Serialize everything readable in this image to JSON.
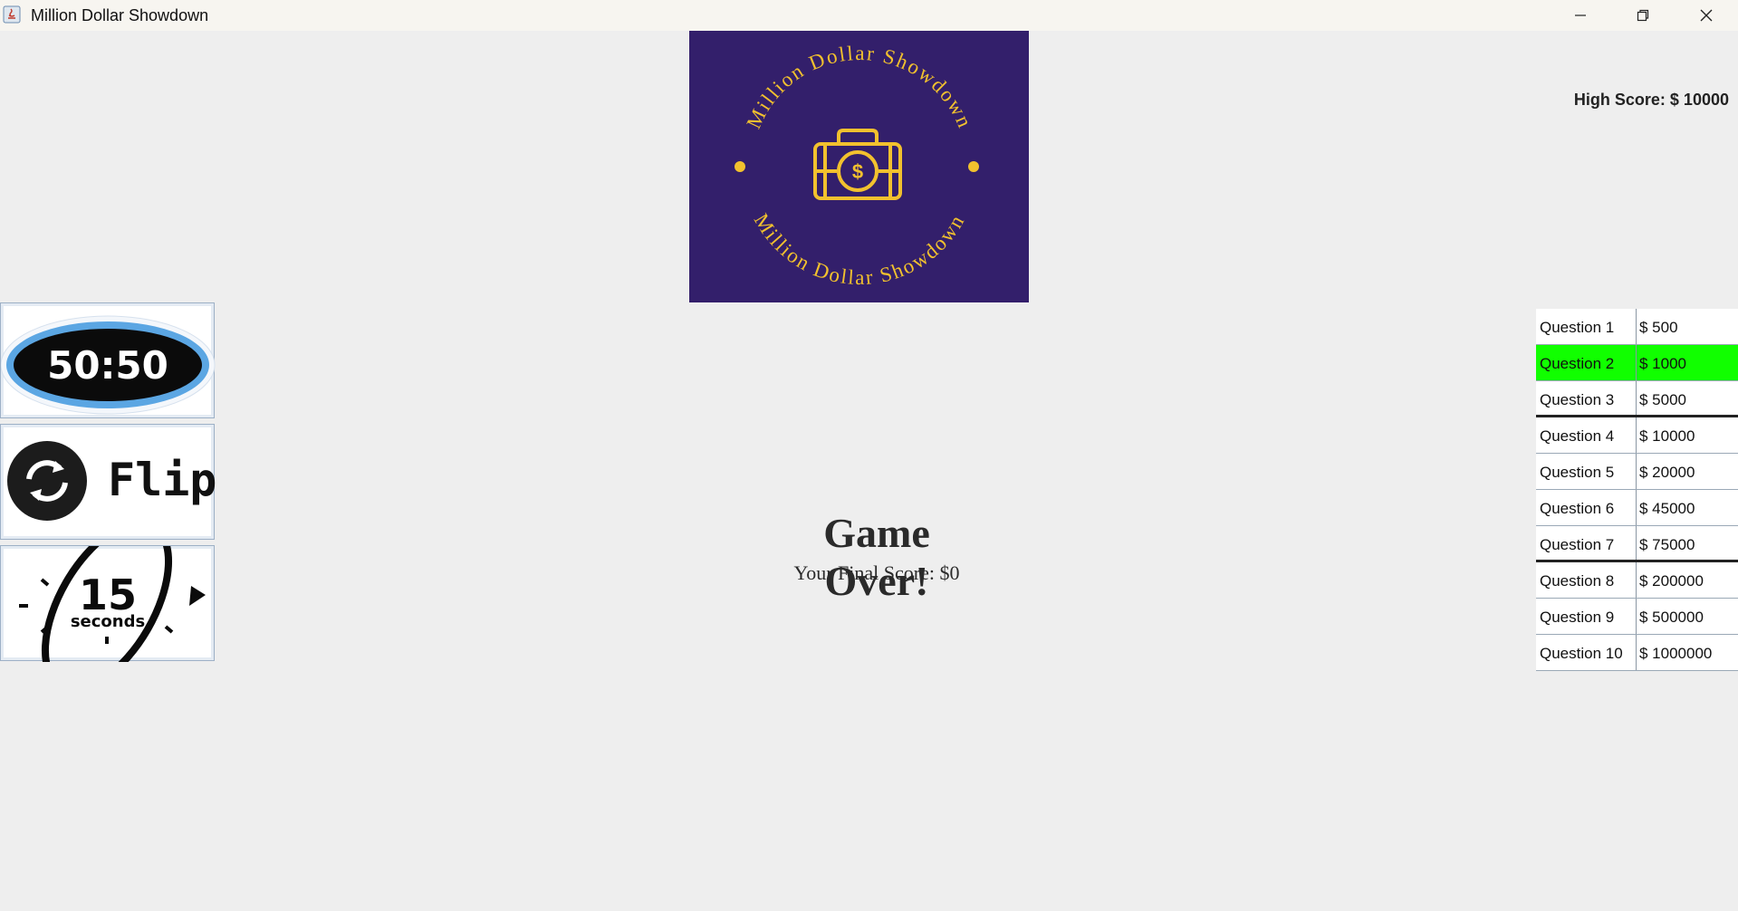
{
  "window": {
    "title": "Million Dollar Showdown"
  },
  "logo": {
    "arc_top": "Million Dollar Showdown",
    "arc_bottom": "Million Dollar Showdown",
    "background": "#331f6b",
    "accent": "#f2c12e"
  },
  "high_score": "High Score: $ 10000",
  "lifelines": [
    {
      "label": "50:50",
      "icon": "fifty-fifty-badge"
    },
    {
      "label": "Flip",
      "icon": "flip-arrows-icon"
    },
    {
      "label_number": "15",
      "label_unit": "seconds",
      "icon": "timer-icon"
    }
  ],
  "result": {
    "title": "Game Over!",
    "subtitle": "Your Final Score: $0"
  },
  "ladder": [
    {
      "question": "Question 1",
      "prize": "$ 500"
    },
    {
      "question": "Question 2",
      "prize": "$ 1000",
      "current": true
    },
    {
      "question": "Question 3",
      "prize": "$ 5000",
      "milestone": true
    },
    {
      "question": "Question 4",
      "prize": "$ 10000"
    },
    {
      "question": "Question 5",
      "prize": "$ 20000"
    },
    {
      "question": "Question 6",
      "prize": "$ 45000"
    },
    {
      "question": "Question 7",
      "prize": "$ 75000",
      "milestone": true
    },
    {
      "question": "Question 8",
      "prize": "$ 200000"
    },
    {
      "question": "Question 9",
      "prize": "$ 500000"
    },
    {
      "question": "Question 10",
      "prize": "$ 1000000"
    }
  ],
  "colors": {
    "highlight": "#11ff00",
    "page_bg": "#eeeeee"
  }
}
